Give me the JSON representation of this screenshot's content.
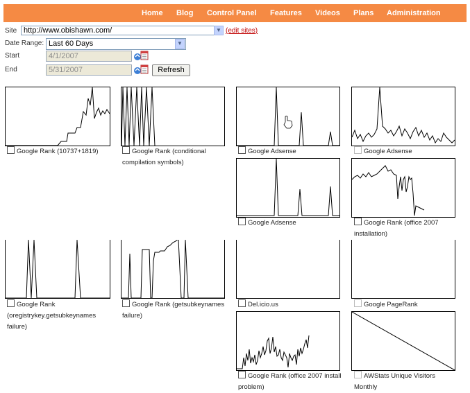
{
  "nav": {
    "items": [
      "Home",
      "Blog",
      "Control Panel",
      "Features",
      "Videos",
      "Plans",
      "Administration"
    ]
  },
  "form": {
    "site_label": "Site",
    "site_value": "http://www.obishawn.com/",
    "edit_sites": "(edit sites)",
    "date_range_label": "Date Range:",
    "date_range_value": "Last 60 Days",
    "start_label": "Start",
    "start_value": "4/1/2007",
    "end_label": "End",
    "end_value": "5/31/2007",
    "refresh_label": "Refresh"
  },
  "charts": [
    {
      "caption": "Google Rank (10737+1819)"
    },
    {
      "caption": "Google Rank (conditional compilation symbols)"
    },
    {
      "caption": "Google Adsense"
    },
    {
      "caption": "Google Adsense"
    },
    {
      "caption": "Google Adsense"
    },
    {
      "caption": "Google Rank (office 2007 installation)"
    },
    {
      "caption": "Google Rank (oregistrykey.getsubkeynames failure)"
    },
    {
      "caption": "Google Rank (getsubkeynames failure)"
    },
    {
      "caption": "Del.icio.us"
    },
    {
      "caption": "Google PageRank"
    },
    {
      "caption": "Google Rank (office 2007 install problem)"
    },
    {
      "caption": "AWStats Unique Visitors Monthly"
    }
  ],
  "colors": {
    "nav": "#f58a44",
    "link": "#c00000"
  }
}
